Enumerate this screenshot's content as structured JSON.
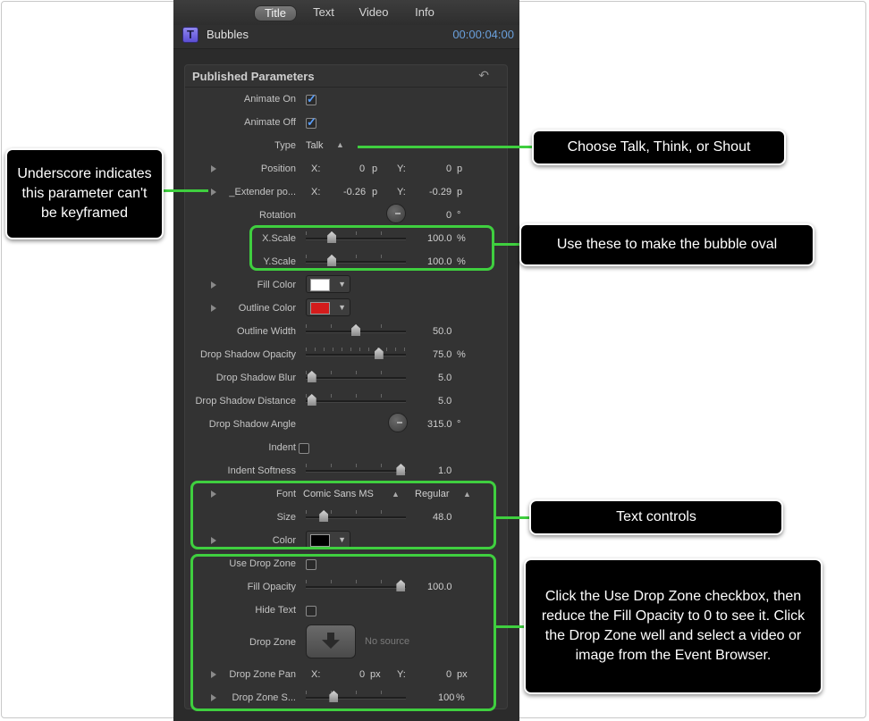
{
  "tabs": [
    "Title",
    "Text",
    "Video",
    "Info"
  ],
  "active_tab": "Title",
  "title_icon_letter": "T",
  "clip_name": "Bubbles",
  "timecode": "00:00:04:00",
  "section_title": "Published Parameters",
  "rows": {
    "animate_on": {
      "label": "Animate On",
      "checked": true
    },
    "animate_off": {
      "label": "Animate Off",
      "checked": true
    },
    "type": {
      "label": "Type",
      "value": "Talk"
    },
    "position": {
      "label": "Position",
      "x_label": "X:",
      "x_value": "0",
      "x_unit": "p",
      "y_label": "Y:",
      "y_value": "0",
      "y_unit": "p"
    },
    "extender": {
      "label": "_Extender po...",
      "x_label": "X:",
      "x_value": "-0.26",
      "x_unit": "p",
      "y_label": "Y:",
      "y_value": "-0.29",
      "y_unit": "p"
    },
    "rotation": {
      "label": "Rotation",
      "value": "0",
      "unit": "°"
    },
    "x_scale": {
      "label": "X.Scale",
      "value": "100.0",
      "unit": "%",
      "slider_fraction": 0.26
    },
    "y_scale": {
      "label": "Y.Scale",
      "value": "100.0",
      "unit": "%",
      "slider_fraction": 0.26
    },
    "fill_color": {
      "label": "Fill Color",
      "color": "#ffffff"
    },
    "outline_color": {
      "label": "Outline Color",
      "color": "#d41c1c"
    },
    "outline_width": {
      "label": "Outline Width",
      "value": "50.0",
      "slider_fraction": 0.5
    },
    "drop_shadow_opacity": {
      "label": "Drop Shadow Opacity",
      "value": "75.0",
      "unit": "%",
      "slider_fraction": 0.73
    },
    "drop_shadow_blur": {
      "label": "Drop Shadow Blur",
      "value": "5.0",
      "slider_fraction": 0.06
    },
    "drop_shadow_distance": {
      "label": "Drop Shadow Distance",
      "value": "5.0",
      "slider_fraction": 0.06
    },
    "drop_shadow_angle": {
      "label": "Drop Shadow Angle",
      "value": "315.0",
      "unit": "°"
    },
    "indent": {
      "label": "Indent",
      "checked": false
    },
    "indent_softness": {
      "label": "Indent Softness",
      "value": "1.0",
      "slider_fraction": 0.95
    },
    "font": {
      "label": "Font",
      "family": "Comic Sans MS",
      "style": "Regular"
    },
    "size": {
      "label": "Size",
      "value": "48.0",
      "slider_fraction": 0.18
    },
    "color": {
      "label": "Color",
      "color": "#000000"
    },
    "use_drop_zone": {
      "label": "Use Drop Zone",
      "checked": false
    },
    "fill_opacity": {
      "label": "Fill Opacity",
      "value": "100.0",
      "slider_fraction": 0.95
    },
    "hide_text": {
      "label": "Hide Text",
      "checked": false
    },
    "drop_zone": {
      "label": "Drop Zone",
      "status": "No source"
    },
    "drop_zone_pan": {
      "label": "Drop Zone Pan",
      "x_label": "X:",
      "x_value": "0",
      "x_unit": "px",
      "y_label": "Y:",
      "y_value": "0",
      "y_unit": "px"
    },
    "drop_zone_scale": {
      "label": "Drop Zone S...",
      "value": "100",
      "unit": "%",
      "slider_fraction": 0.28
    }
  },
  "callouts": {
    "underscore": "Underscore indicates this parameter can't be keyframed",
    "type": "Choose Talk, Think, or Shout",
    "scale": "Use these to make the bubble oval",
    "text": "Text controls",
    "dropzone": "Click the Use Drop Zone checkbox, then reduce the Fill Opacity to 0 to see it. Click the Drop Zone well and select a video or image from the Event Browser."
  },
  "colors": {
    "accent_green": "#3fcf3f",
    "timecode_blue": "#6aa0dc",
    "panel_bg": "#2b2b2b"
  }
}
